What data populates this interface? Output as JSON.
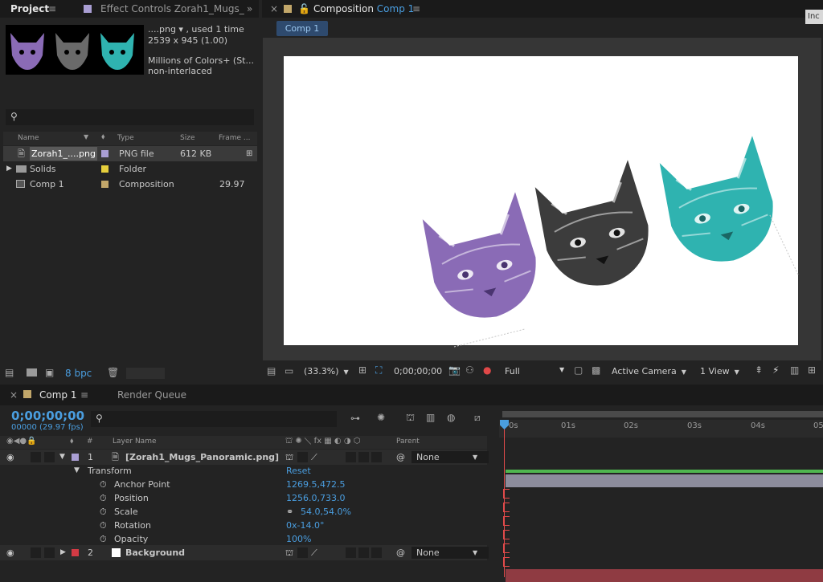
{
  "project": {
    "tab_project": "Project",
    "tab_effect_controls": "Effect Controls Zorah1_Mugs_",
    "info": {
      "name_line": "....png ▾ , used 1 time",
      "dims": "2539 x 945 (1.00)",
      "colors": "Millions of Colors+ (St...",
      "interlace": "non-interlaced"
    },
    "columns": {
      "name": "Name",
      "type": "Type",
      "size": "Size",
      "frame": "Frame ..."
    },
    "items": [
      {
        "name": "Zorah1_....png",
        "type": "PNG file",
        "size": "612 KB",
        "frame": "",
        "color": "#a99ed3"
      },
      {
        "name": "Solids",
        "type": "Folder",
        "size": "",
        "frame": "",
        "color": "#e6cf3c"
      },
      {
        "name": "Comp 1",
        "type": "Composition",
        "size": "",
        "frame": "29.97",
        "color": "#c2a76a"
      }
    ],
    "bpc": "8 bpc"
  },
  "composition": {
    "tab_label": "Composition",
    "tab_comp": "Comp 1",
    "subtab": "Comp 1",
    "corner_label": "Inc",
    "footer": {
      "zoom": "(33.3%)",
      "timecode": "0;00;00;00",
      "resolution": "Full",
      "camera": "Active Camera",
      "views": "1 View"
    }
  },
  "timeline": {
    "tab_comp": "Comp 1",
    "tab_render": "Render Queue",
    "timecode": "0;00;00;00",
    "fps": "00000 (29.97 fps)",
    "headers": {
      "num": "#",
      "layer_name": "Layer Name",
      "parent": "Parent"
    },
    "ruler_ticks": [
      "0s",
      "01s",
      "02s",
      "03s",
      "04s",
      "05"
    ],
    "layers": [
      {
        "num": "1",
        "name": "[Zorah1_Mugs_Panoramic.png]",
        "parent": "None",
        "color": "#a99ed3"
      },
      {
        "num": "2",
        "name": "Background",
        "parent": "None",
        "color": "#d23a44"
      }
    ],
    "transform": {
      "label": "Transform",
      "reset": "Reset",
      "properties": [
        {
          "name": "Anchor Point",
          "value": "1269.5,472.5"
        },
        {
          "name": "Position",
          "value": "1256.0,733.0"
        },
        {
          "name": "Scale",
          "value": "54.0,54.0%"
        },
        {
          "name": "Rotation",
          "value": "0x-14.0°"
        },
        {
          "name": "Opacity",
          "value": "100%"
        }
      ]
    }
  },
  "colors": {
    "accent_blue": "#4a9ee0",
    "purple_cat": "#8a6bb6",
    "gray_cat": "#3c3c3c",
    "teal_cat": "#2fb3b0"
  }
}
